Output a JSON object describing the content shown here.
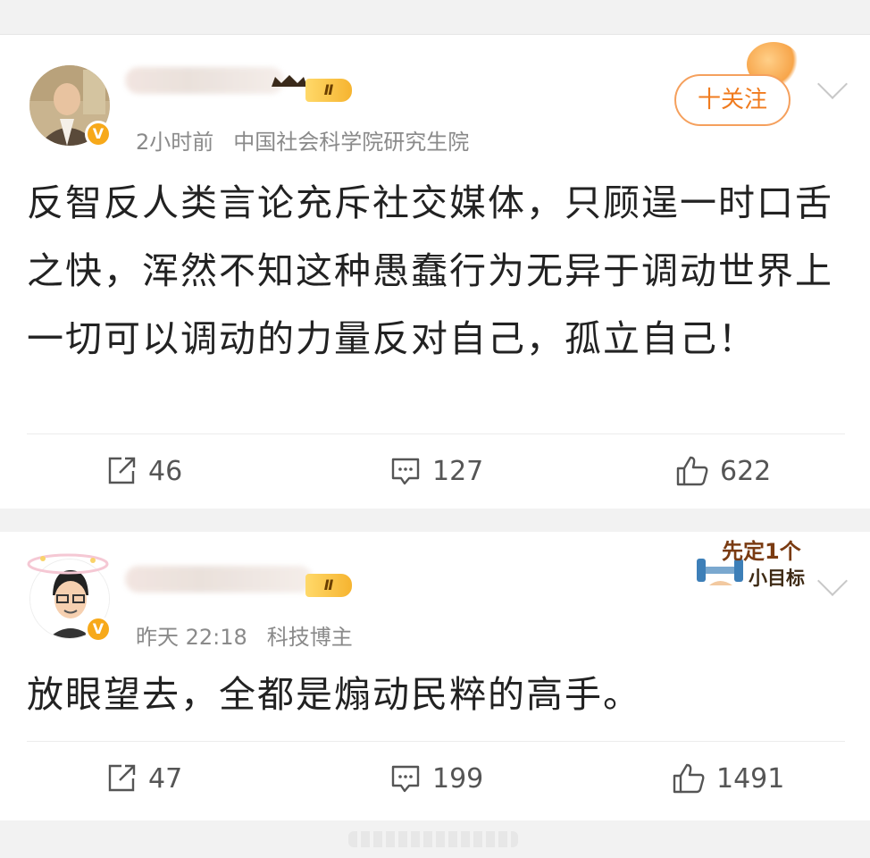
{
  "posts": [
    {
      "vip_level": "Ⅱ",
      "time": "2小时前",
      "source": "中国社会科学院研究生院",
      "follow_label": "十关注",
      "text": "反智反人类言论充斥社交媒体，只顾逞一时口舌之快，浑然不知这种愚蠢行为无异于调动世界上一切可以调动的力量反对自己，孤立自己！",
      "repost_count": "46",
      "comment_count": "127",
      "like_count": "622"
    },
    {
      "vip_level": "Ⅱ",
      "time": "昨天 22:18",
      "source": "科技博主",
      "sticker_line1": "先定1个",
      "sticker_line2": "小目标",
      "text": "放眼望去，全都是煽动民粹的高手。",
      "repost_count": "47",
      "comment_count": "199",
      "like_count": "1491"
    }
  ],
  "icons": {
    "verified": "V",
    "repost": "share-box-icon",
    "comment": "comment-icon",
    "like": "thumbs-up-icon"
  },
  "colors": {
    "accent_orange": "#f07b1e",
    "verified_badge": "#f7a91a",
    "meta_gray": "#8a8a8a"
  }
}
